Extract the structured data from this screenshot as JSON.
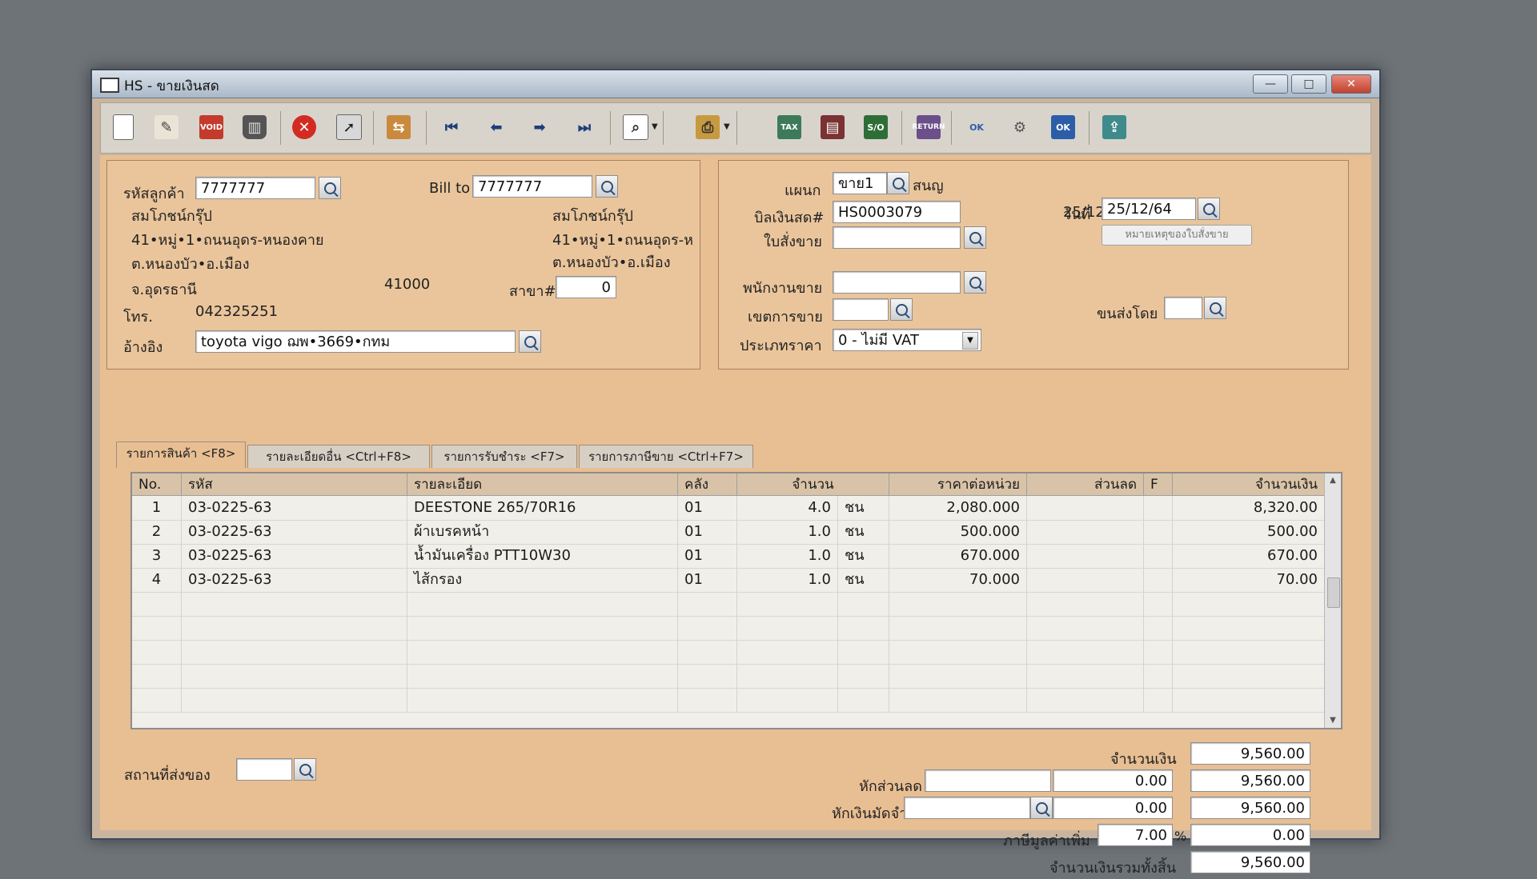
{
  "window": {
    "title": "HS - ขายเงินสด",
    "controls": {
      "minimize": "—",
      "maximize": "□",
      "close": "✕"
    }
  },
  "toolbar": {
    "icons": [
      "new-doc-icon",
      "edit-icon",
      "void-icon",
      "delete-bin-icon",
      "cancel-icon",
      "select-cursor-icon",
      "transfer-icon",
      "first-record-icon",
      "previous-record-icon",
      "next-record-icon",
      "last-record-icon",
      "find-icon",
      "printer-icon",
      "tax-icon",
      "form-icon",
      "so-icon",
      "return-icon",
      "approve-ok-icon",
      "tools-icon",
      "ok-confirm-icon",
      "export-icon"
    ]
  },
  "customer": {
    "code_label": "รหัสลูกค้า",
    "code_value": "7777777",
    "name": "สมโภชน์กรุ๊ป",
    "address1": "41•หมู่•1•ถนนอุดร-หนองคาย",
    "address2": "ต.หนองบัว•อ.เมือง",
    "province": "จ.อุดรธานี",
    "postcode": "41000",
    "phone_label": "โทร.",
    "phone": "042325251",
    "ref_label": "อ้างอิง",
    "ref_value": "toyota vigo ฌพ•3669•กทม"
  },
  "bill_to": {
    "label": "Bill to",
    "value": "7777777",
    "name": "สมโภชน์กรุ๊ป",
    "address1": "41•หมู่•1•ถนนอุดร-ห",
    "address2": "ต.หนองบัว•อ.เมือง",
    "branch_label": "สาขา#",
    "branch_value": "0"
  },
  "document": {
    "dept_label": "แผนก",
    "dept_value": "ขาย1",
    "dept_name": "สนญ",
    "bill_no_label": "บิลเงินสด#",
    "bill_no_value": "HS0003079",
    "order_label": "ใบสั่งขาย",
    "order_value": "",
    "date_label": "วันที่",
    "date_value": "25/12/64",
    "remark_button": "หมายเหตุของใบสั่งขาย",
    "salesperson_label": "พนักงานขาย",
    "salesperson_value": "",
    "area_label": "เขตการขาย",
    "area_value": "",
    "shipby_label": "ขนส่งโดย",
    "shipby_value": "",
    "price_type_label": "ประเภทราคา",
    "price_type_value": "0 - ไม่มี VAT"
  },
  "tabs": [
    {
      "label": "รายการสินค้า <F8>"
    },
    {
      "label": "รายละเอียดอื่น <Ctrl+F8>"
    },
    {
      "label": "รายการรับชำระ <F7>"
    },
    {
      "label": "รายการภาษีขาย <Ctrl+F7>"
    }
  ],
  "grid": {
    "headers": {
      "no": "No.",
      "code": "รหัส",
      "desc": "รายละเอียด",
      "wh": "คลัง",
      "qty": "จำนวน",
      "price": "ราคาต่อหน่วย",
      "discount": "ส่วนลด",
      "f": "F",
      "amount": "จำนวนเงิน"
    },
    "rows": [
      {
        "no": "1",
        "code": "03-0225-63",
        "desc": "DEESTONE 265/70R16",
        "wh": "01",
        "qty": "4.0",
        "unit": "ชน",
        "price": "2,080.000",
        "discount": "",
        "f": "",
        "amount": "8,320.00"
      },
      {
        "no": "2",
        "code": "03-0225-63",
        "desc": "ผ้าเบรคหน้า",
        "wh": "01",
        "qty": "1.0",
        "unit": "ชน",
        "price": "500.000",
        "discount": "",
        "f": "",
        "amount": "500.00"
      },
      {
        "no": "3",
        "code": "03-0225-63",
        "desc": "น้ำมันเครื่อง PTT10W30",
        "wh": "01",
        "qty": "1.0",
        "unit": "ชน",
        "price": "670.000",
        "discount": "",
        "f": "",
        "amount": "670.00"
      },
      {
        "no": "4",
        "code": "03-0225-63",
        "desc": "ไส้กรอง",
        "wh": "01",
        "qty": "1.0",
        "unit": "ชน",
        "price": "70.000",
        "discount": "",
        "f": "",
        "amount": "70.00"
      }
    ]
  },
  "footer": {
    "ship_place_label": "สถานที่ส่งของ",
    "ship_place_value": "",
    "amount_label": "จำนวนเงิน",
    "amount_value": "9,560.00",
    "discount_label": "หักส่วนลด",
    "discount_input": "",
    "discount_value": "0.00",
    "after_discount": "9,560.00",
    "deposit_label": "หักเงินมัดจำ",
    "deposit_input": "",
    "deposit_value": "0.00",
    "after_deposit": "9,560.00",
    "vat_label": "ภาษีมูลค่าเพิ่ม",
    "vat_rate": "7.00",
    "vat_percent": "%",
    "vat_value": "0.00",
    "total_label": "จำนวนเงินรวมทั้งสิ้น",
    "total_value": "9,560.00"
  }
}
